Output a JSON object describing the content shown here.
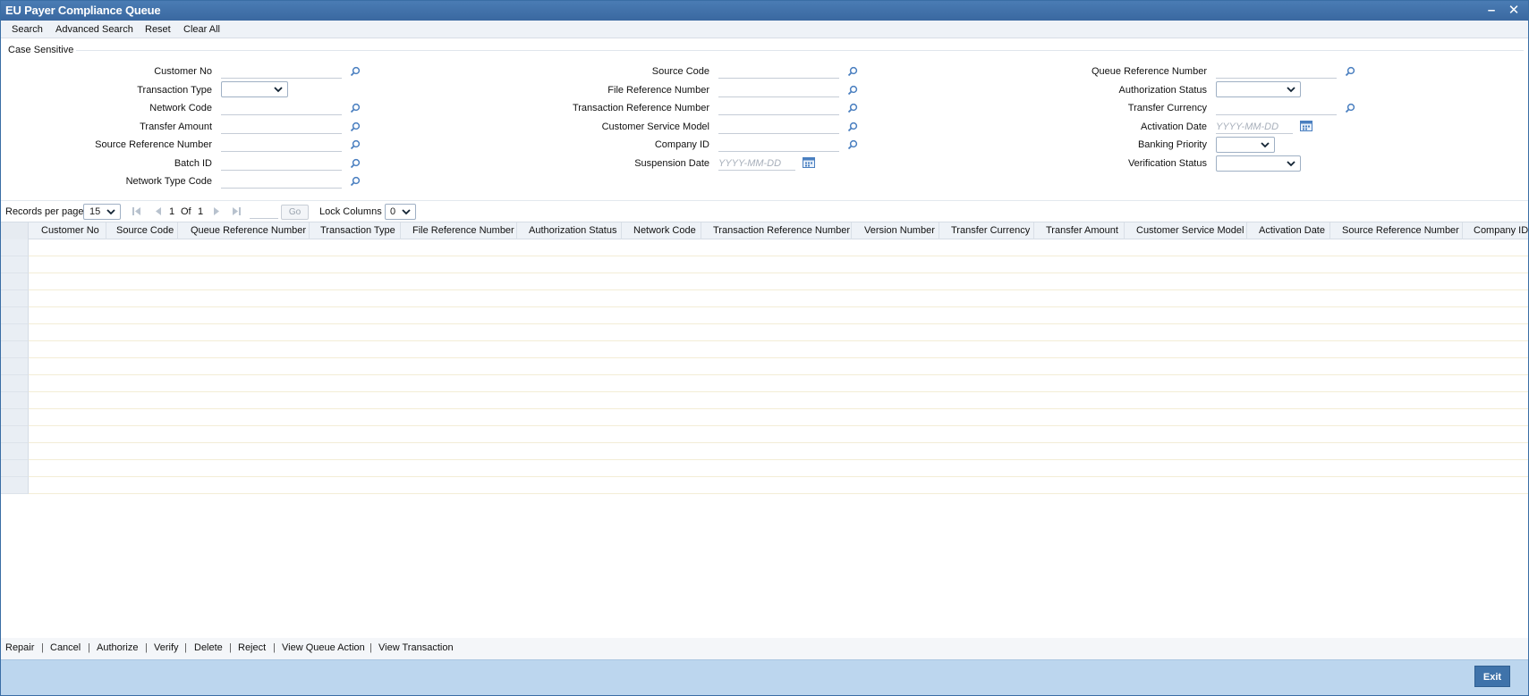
{
  "window": {
    "title": "EU Payer Compliance Queue"
  },
  "toolbar": {
    "search": "Search",
    "advanced_search": "Advanced Search",
    "reset": "Reset",
    "clear_all": "Clear All"
  },
  "form": {
    "section_label": "Case Sensitive",
    "customer_no": "Customer No",
    "transaction_type": "Transaction Type",
    "network_code": "Network Code",
    "transfer_amount": "Transfer Amount",
    "source_reference_number": "Source Reference Number",
    "batch_id": "Batch ID",
    "network_type_code": "Network Type Code",
    "source_code": "Source Code",
    "file_reference_number": "File Reference Number",
    "transaction_reference_number": "Transaction Reference Number",
    "customer_service_model": "Customer Service Model",
    "company_id": "Company ID",
    "suspension_date": "Suspension Date",
    "queue_reference_number": "Queue Reference Number",
    "authorization_status": "Authorization Status",
    "transfer_currency": "Transfer Currency",
    "activation_date": "Activation Date",
    "banking_priority": "Banking Priority",
    "verification_status": "Verification Status",
    "date_placeholder": "YYYY-MM-DD"
  },
  "pager": {
    "records_per_page_label": "Records per page",
    "records_per_page_value": "15",
    "current_page": "1",
    "of_label": "Of",
    "total_pages": "1",
    "go_label": "Go",
    "lock_columns_label": "Lock Columns",
    "lock_columns_value": "0"
  },
  "grid": {
    "columns": [
      "Customer No",
      "Source Code",
      "Queue Reference Number",
      "Transaction Type",
      "File Reference Number",
      "Authorization Status",
      "Network Code",
      "Transaction Reference Number",
      "Version Number",
      "Transfer Currency",
      "Transfer Amount",
      "Customer Service Model",
      "Activation Date",
      "Source Reference Number",
      "Company ID"
    ],
    "empty_rows": 15
  },
  "actions": {
    "repair": "Repair",
    "cancel": "Cancel",
    "authorize": "Authorize",
    "verify": "Verify",
    "delete": "Delete",
    "reject": "Reject",
    "view_queue_action": "View Queue Action",
    "view_transaction": "View Transaction",
    "separator": "|"
  },
  "footer": {
    "exit": "Exit"
  },
  "colors": {
    "titlebar": "#3a68a0",
    "footer": "#bcd6ee",
    "exit_button": "#3f73aa",
    "lov_icon": "#4a7fc0"
  },
  "icons": {
    "lov": "search-icon",
    "calendar": "calendar-icon",
    "dropdown": "chevron-down-icon"
  }
}
